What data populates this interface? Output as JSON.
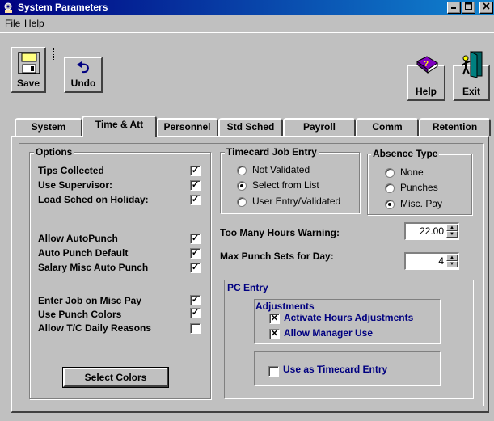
{
  "window": {
    "title": "System Parameters",
    "app_icon": "gear-hand-icon"
  },
  "menu": {
    "file": "File",
    "help": "Help"
  },
  "toolbar": {
    "save_label": "Save",
    "undo_label": "Undo",
    "help_label": "Help",
    "exit_label": "Exit"
  },
  "tabs": [
    {
      "label": "System",
      "active": false
    },
    {
      "label": "Time & Att",
      "active": true
    },
    {
      "label": "Personnel",
      "active": false
    },
    {
      "label": "Std Sched",
      "active": false
    },
    {
      "label": "Payroll",
      "active": false
    },
    {
      "label": "Comm",
      "active": false
    },
    {
      "label": "Retention",
      "active": false
    }
  ],
  "options": {
    "title": "Options",
    "items": [
      {
        "label": "Tips Collected",
        "checked": true
      },
      {
        "label": "Use Supervisor:",
        "checked": true
      },
      {
        "label": "Load Sched on Holiday:",
        "checked": true
      },
      {
        "label": "Allow AutoPunch",
        "checked": true
      },
      {
        "label": "Auto Punch Default",
        "checked": true
      },
      {
        "label": "Salary Misc Auto Punch",
        "checked": true
      },
      {
        "label": "Enter Job on Misc Pay",
        "checked": true
      },
      {
        "label": "Use Punch Colors",
        "checked": true
      },
      {
        "label": "Allow T/C Daily Reasons",
        "checked": false
      }
    ],
    "select_colors_label": "Select Colors"
  },
  "timecard_job_entry": {
    "title": "Timecard Job Entry",
    "options": [
      {
        "label": "Not Validated",
        "selected": false
      },
      {
        "label": "Select from List",
        "selected": true
      },
      {
        "label": "User Entry/Validated",
        "selected": false
      }
    ]
  },
  "absence_type": {
    "title": "Absence Type",
    "options": [
      {
        "label": "None",
        "selected": false
      },
      {
        "label": "Punches",
        "selected": false
      },
      {
        "label": "Misc. Pay",
        "selected": true
      }
    ]
  },
  "too_many_hours": {
    "label": "Too Many Hours Warning:",
    "value": "22.00"
  },
  "max_punch_sets": {
    "label": "Max Punch Sets for Day:",
    "value": "4"
  },
  "pc_entry": {
    "title": "PC Entry",
    "adjustments_title": "Adjustments",
    "activate_hours_label": "Activate Hours Adjustments",
    "activate_hours_checked": true,
    "allow_manager_label": "Allow Manager Use",
    "allow_manager_checked": true,
    "use_as_timecard_label": "Use as Timecard Entry",
    "use_as_timecard_checked": false
  }
}
